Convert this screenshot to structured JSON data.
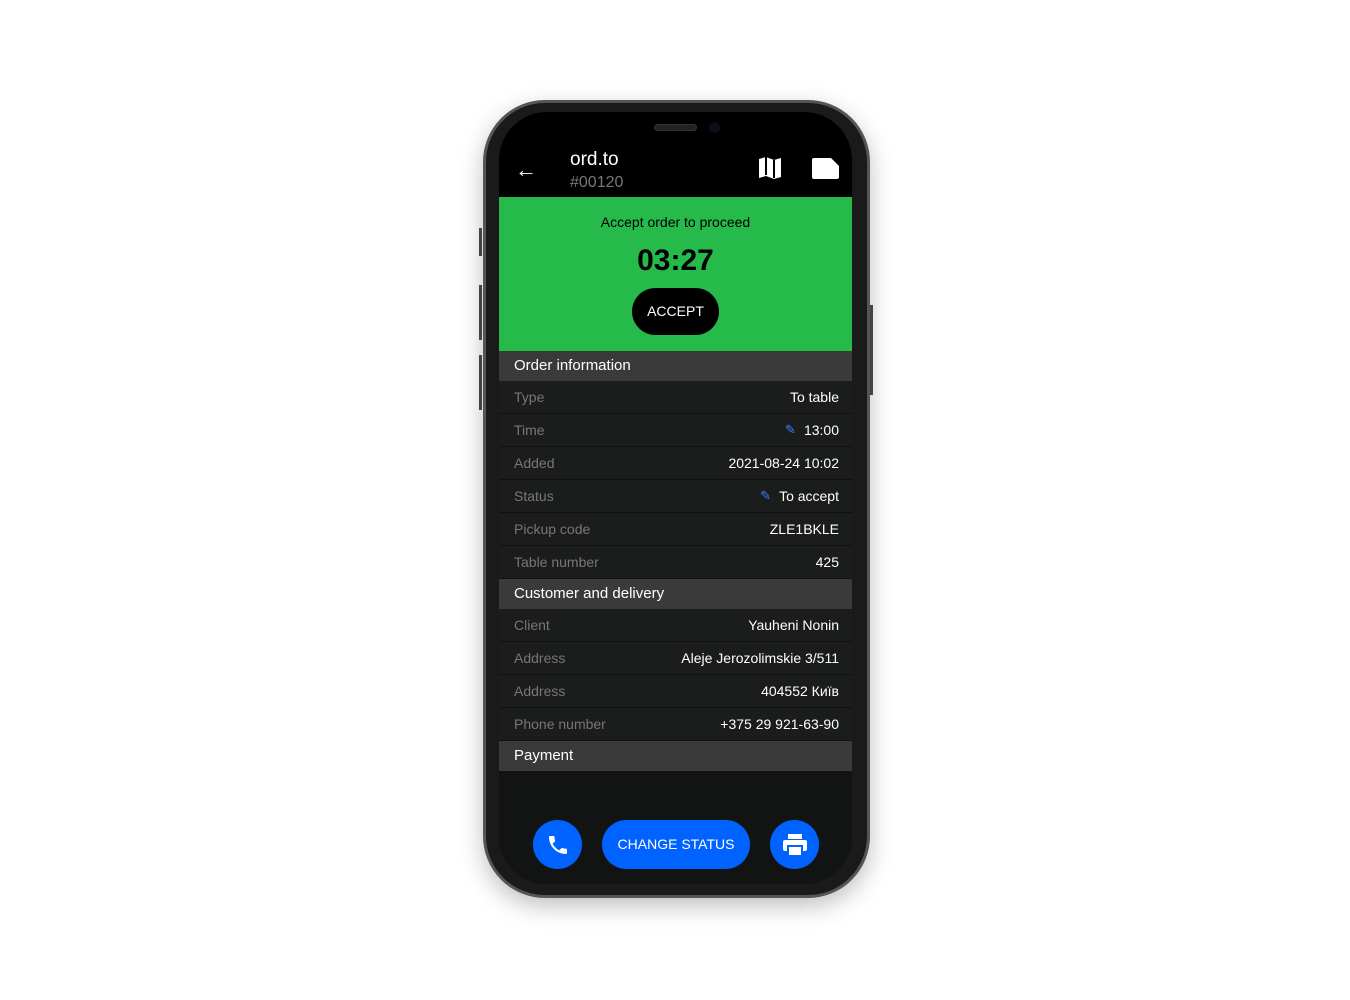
{
  "header": {
    "title": "ord.to",
    "order_number": "#00120",
    "back_icon": "arrow-left-icon",
    "map_icon": "map-icon",
    "note_icon": "note-icon"
  },
  "banner": {
    "message": "Accept order to proceed",
    "timer": "03:27",
    "accept_label": "ACCEPT",
    "color": "#26ba4b"
  },
  "order_information": {
    "title": "Order information",
    "rows": [
      {
        "label": "Type",
        "value": "To table"
      },
      {
        "label": "Time",
        "value": "13:00",
        "editable": true
      },
      {
        "label": "Added",
        "value": "2021-08-24 10:02"
      },
      {
        "label": "Status",
        "value": "To accept",
        "editable": true
      },
      {
        "label": "Pickup code",
        "value": "ZLE1BKLE"
      },
      {
        "label": "Table number",
        "value": "425"
      }
    ]
  },
  "customer": {
    "title": "Customer and delivery",
    "rows": [
      {
        "label": "Client",
        "value": "Yauheni Nonin"
      },
      {
        "label": "Address",
        "value": "Aleje Jerozolimskie 3/511"
      },
      {
        "label": "Address",
        "value": "404552 Київ"
      },
      {
        "label": "Phone number",
        "value": "+375 29 921-63-90"
      }
    ]
  },
  "payment": {
    "title": "Payment"
  },
  "actions": {
    "change_status_label": "CHANGE STATUS",
    "phone_icon": "phone-icon",
    "print_icon": "printer-icon",
    "accent": "#0062ff"
  }
}
